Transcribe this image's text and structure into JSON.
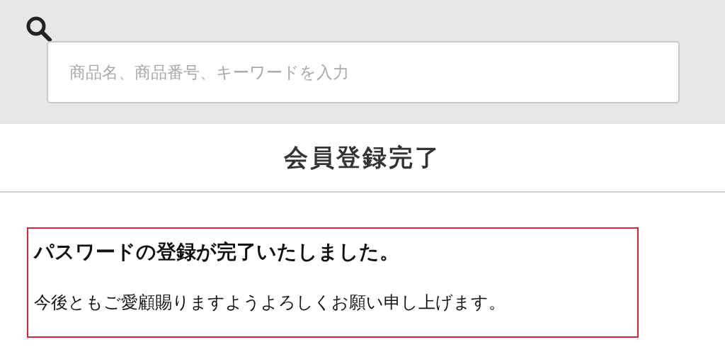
{
  "search": {
    "placeholder": "商品名、商品番号、キーワードを入力"
  },
  "page_title": "会員登録完了",
  "notice": {
    "heading": "パスワードの登録が完了いたしました。",
    "message": "今後ともご愛顧賜りますようよろしくお願い申し上げます。"
  }
}
